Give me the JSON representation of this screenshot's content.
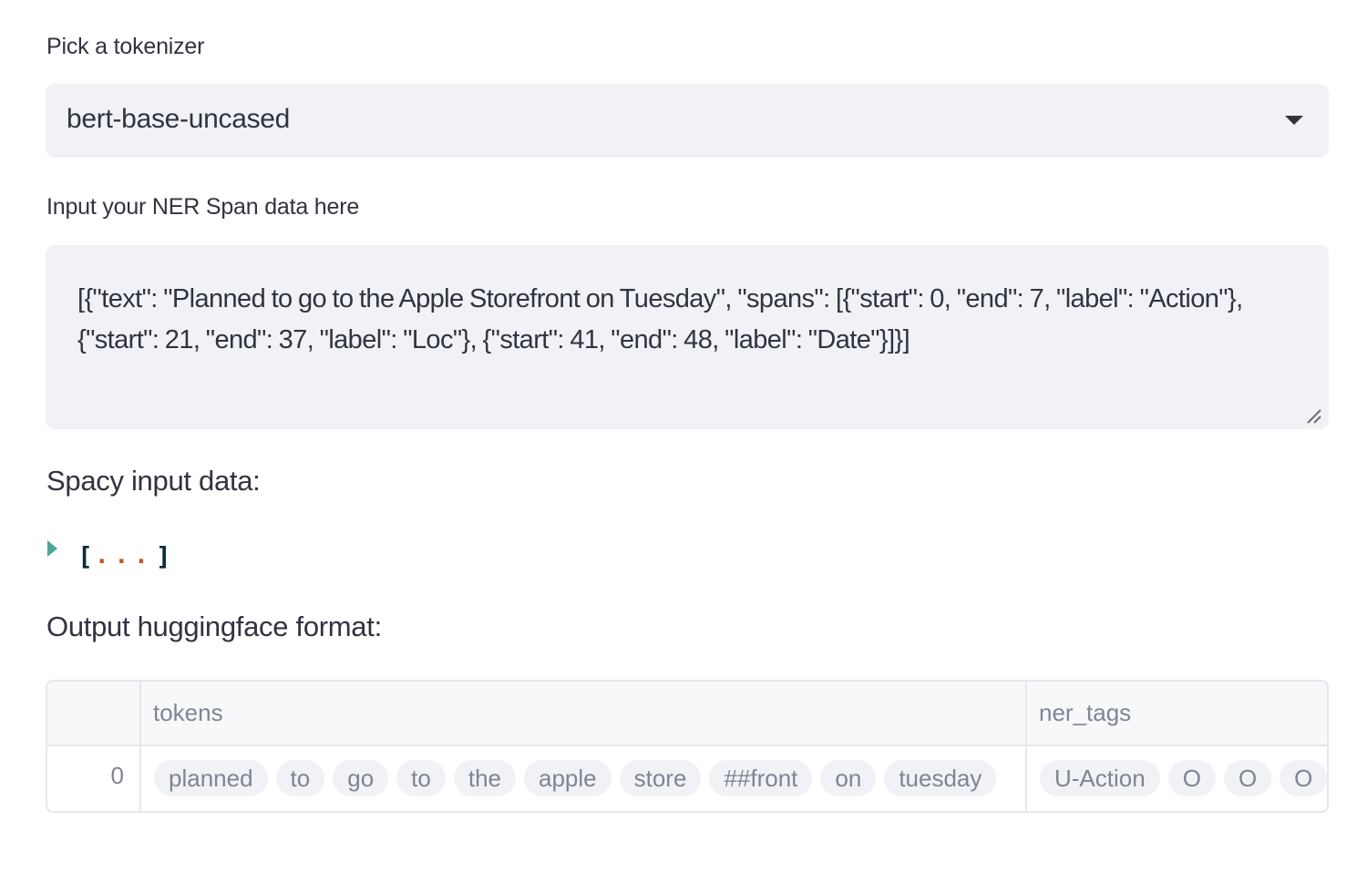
{
  "tokenizer": {
    "label": "Pick a tokenizer",
    "selected": "bert-base-uncased"
  },
  "ner_input": {
    "label": "Input your NER Span data here",
    "value": "[{\"text\": \"Planned to go to the Apple Storefront on Tuesday\", \"spans\": [{\"start\": 0, \"end\": 7, \"label\": \"Action\"}, {\"start\": 21, \"end\": 37, \"label\": \"Loc\"}, {\"start\": 41, \"end\": 48, \"label\": \"Date\"}]}]"
  },
  "spacy_section": {
    "heading": "Spacy input data:",
    "json_collapsed": {
      "open_bracket": "[",
      "ellipsis": "...",
      "close_bracket": "]"
    }
  },
  "output_section": {
    "heading": "Output huggingface format:",
    "table": {
      "columns": [
        "",
        "tokens",
        "ner_tags"
      ],
      "rows": [
        {
          "index": "0",
          "tokens": [
            "planned",
            "to",
            "go",
            "to",
            "the",
            "apple",
            "store",
            "##front",
            "on",
            "tuesday"
          ],
          "ner_tags": [
            "U-Action",
            "O",
            "O",
            "O"
          ]
        }
      ]
    }
  },
  "colors": {
    "input_bg": "#f0f2f6",
    "text": "#31333f",
    "muted_text": "#808493",
    "caret_teal": "#4ca69a",
    "ellipsis_orange": "#c2552a"
  }
}
